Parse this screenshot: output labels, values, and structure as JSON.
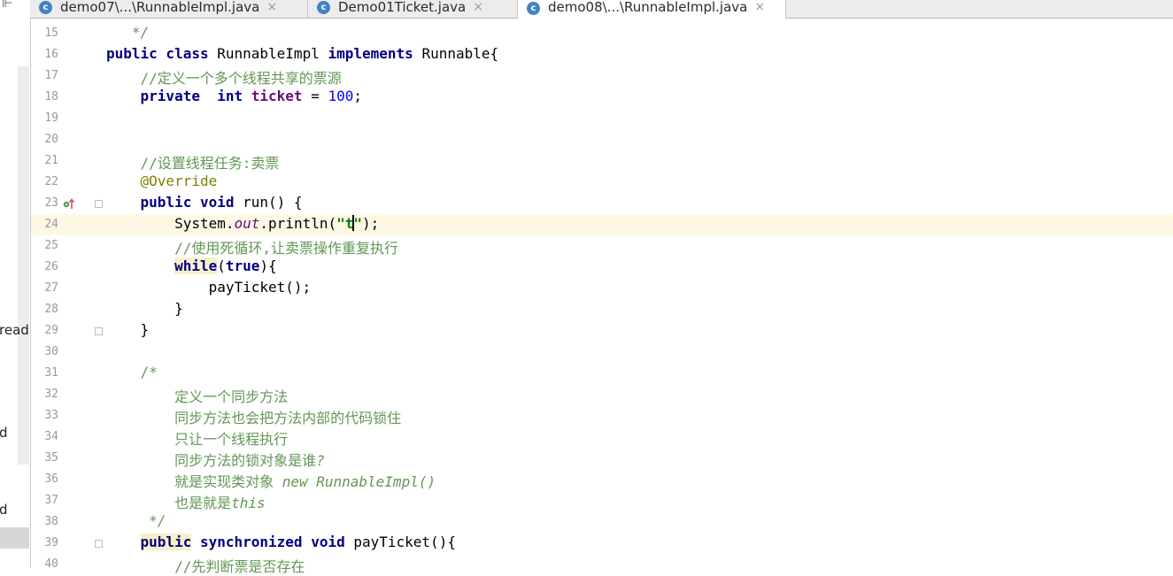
{
  "left_panel": {
    "tool_glyph": "⊩",
    "fragments": [
      "read",
      "d",
      "d"
    ]
  },
  "tabs": [
    {
      "label": "demo07\\...\\RunnableImpl.java",
      "icon": "class-c-icon",
      "active": false
    },
    {
      "label": "Demo01Ticket.java",
      "icon": "class-c-icon",
      "active": false
    },
    {
      "label": "demo08\\...\\RunnableImpl.java",
      "icon": "class-c-icon",
      "active": true
    }
  ],
  "tab_icon_letter": "c",
  "close_glyph": "×",
  "current_line": 24,
  "code_lines": [
    {
      "n": "15",
      "tokens": [
        [
          "cm",
          "   */"
        ]
      ]
    },
    {
      "n": "16",
      "tokens": [
        [
          "k",
          "public class "
        ],
        [
          "",
          "RunnableImpl "
        ],
        [
          "k",
          "implements "
        ],
        [
          "",
          "Runnable{"
        ]
      ]
    },
    {
      "n": "17",
      "tokens": [
        [
          "",
          "    "
        ],
        [
          "cz",
          "//定义一个多个线程共享的票源"
        ]
      ]
    },
    {
      "n": "18",
      "tokens": [
        [
          "",
          "    "
        ],
        [
          "k",
          "private  int "
        ],
        [
          "f",
          "ticket"
        ],
        [
          "",
          " = "
        ],
        [
          "n",
          "100"
        ],
        [
          "",
          ";"
        ]
      ]
    },
    {
      "n": "19",
      "tokens": []
    },
    {
      "n": "20",
      "tokens": []
    },
    {
      "n": "21",
      "tokens": [
        [
          "",
          "    "
        ],
        [
          "cz",
          "//设置线程任务:卖票"
        ]
      ]
    },
    {
      "n": "22",
      "tokens": [
        [
          "",
          "    "
        ],
        [
          "an",
          "@Override"
        ]
      ]
    },
    {
      "n": "23",
      "tokens": [
        [
          "",
          "    "
        ],
        [
          "k",
          "public void "
        ],
        [
          "",
          "run() {"
        ]
      ]
    },
    {
      "n": "24",
      "tokens": [
        [
          "",
          "        System."
        ],
        [
          "st",
          "out"
        ],
        [
          "",
          ".println("
        ],
        [
          "s",
          "\"t"
        ],
        [
          "caret",
          ""
        ],
        [
          "s",
          "\""
        ],
        [
          "",
          ");"
        ]
      ]
    },
    {
      "n": "25",
      "tokens": [
        [
          "",
          "        "
        ],
        [
          "cz",
          "//使用死循环,让卖票操作重复执行"
        ]
      ]
    },
    {
      "n": "26",
      "tokens": [
        [
          "",
          "        "
        ],
        [
          "khl",
          "while"
        ],
        [
          "",
          "("
        ],
        [
          "k",
          "true"
        ],
        [
          "",
          "){"
        ]
      ]
    },
    {
      "n": "27",
      "tokens": [
        [
          "",
          "            payTicket();"
        ]
      ]
    },
    {
      "n": "28",
      "tokens": [
        [
          "",
          "        }"
        ]
      ]
    },
    {
      "n": "29",
      "tokens": [
        [
          "",
          "    }"
        ]
      ]
    },
    {
      "n": "30",
      "tokens": []
    },
    {
      "n": "31",
      "tokens": [
        [
          "",
          "    "
        ],
        [
          "dc",
          "/*"
        ]
      ]
    },
    {
      "n": "32",
      "tokens": [
        [
          "",
          "        "
        ],
        [
          "dc",
          "定义一个同步方法"
        ]
      ]
    },
    {
      "n": "33",
      "tokens": [
        [
          "",
          "        "
        ],
        [
          "dc",
          "同步方法也会把方法内部的代码锁住"
        ]
      ]
    },
    {
      "n": "34",
      "tokens": [
        [
          "",
          "        "
        ],
        [
          "dc",
          "只让一个线程执行"
        ]
      ]
    },
    {
      "n": "35",
      "tokens": [
        [
          "",
          "        "
        ],
        [
          "dc",
          "同步方法的锁对象是谁"
        ],
        [
          "dci",
          "?"
        ]
      ]
    },
    {
      "n": "36",
      "tokens": [
        [
          "",
          "        "
        ],
        [
          "dc",
          "就是实现类对象 "
        ],
        [
          "dci",
          "new RunnableImpl()"
        ]
      ]
    },
    {
      "n": "37",
      "tokens": [
        [
          "",
          "        "
        ],
        [
          "dc",
          "也是就是"
        ],
        [
          "dci",
          "this"
        ]
      ]
    },
    {
      "n": "38",
      "tokens": [
        [
          "",
          "     "
        ],
        [
          "dci",
          "*/"
        ]
      ]
    },
    {
      "n": "39",
      "tokens": [
        [
          "",
          "    "
        ],
        [
          "khl",
          "public"
        ],
        [
          "",
          " "
        ],
        [
          "k",
          "synchronized void "
        ],
        [
          "",
          "payTicket(){"
        ]
      ]
    },
    {
      "n": "40",
      "tokens": [
        [
          "",
          "        "
        ],
        [
          "cz",
          "//先判断票是否存在"
        ]
      ]
    }
  ],
  "gutter_marks": {
    "override_line": "23",
    "fold_lines": [
      "23",
      "29",
      "39"
    ],
    "override_icon": "override-arrow-icon",
    "fold_icon": "fold-marker-icon"
  },
  "colors": {
    "keyword": "#000080",
    "string": "#008000",
    "number": "#0000ff",
    "comment": "#629755",
    "annotation": "#808000",
    "field": "#660e7a",
    "current_line_bg": "#fdf8e3"
  }
}
